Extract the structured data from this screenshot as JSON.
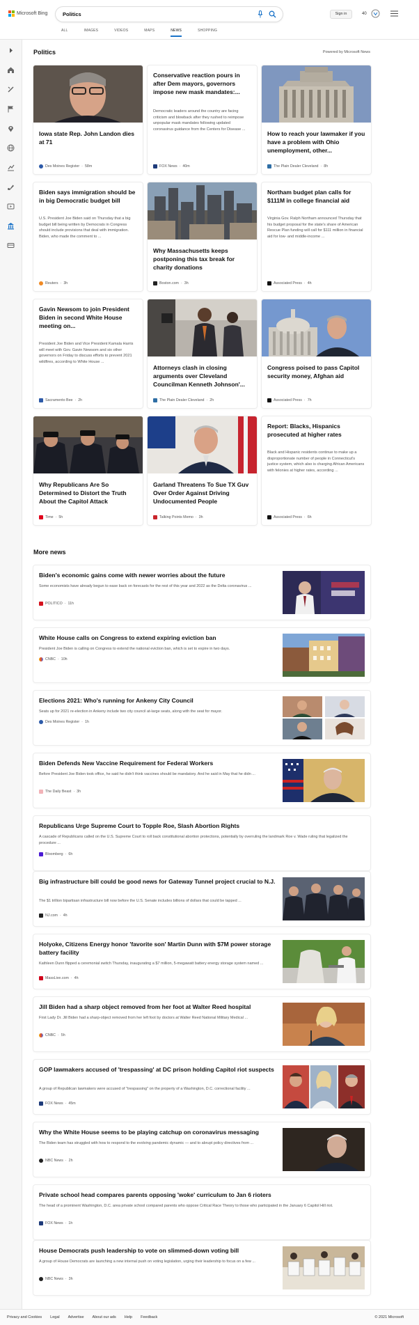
{
  "header": {
    "logo_text": "Microsoft Bing",
    "search_value": "Politics",
    "signin_label": "Sign in",
    "rewards_count": "40",
    "tabs": [
      "ALL",
      "IMAGES",
      "VIDEOS",
      "MAPS",
      "NEWS",
      "SHOPPING"
    ],
    "active_tab": "NEWS"
  },
  "colors": {
    "accent": "#1a73c8",
    "logo": [
      "#f25022",
      "#7fba00",
      "#00a4ef",
      "#ffb900"
    ]
  },
  "sidebar_icons": [
    "expand-icon",
    "home-icon",
    "sports-icon",
    "flag-icon",
    "location-icon",
    "world-icon",
    "money-icon",
    "science-icon",
    "entertainment-icon",
    "politics-icon",
    "more-icon"
  ],
  "section": {
    "title": "Politics",
    "powered_by": "Powered by Microsoft News"
  },
  "cards": [
    {
      "title": "Iowa state Rep. John Landon dies at 71",
      "desc": "",
      "source": "Des Moines Register",
      "time": "58m"
    },
    {
      "title": "Conservative reaction pours in after Dem mayors, governors impose new mask mandates:...",
      "desc": "Democratic leaders around the country are facing criticism and blowback after they rushed to reimpose unpopular mask mandates following updated coronavirus guidance from the Centers for Disease ...",
      "source": "FOX News",
      "time": "40m"
    },
    {
      "title": "How to reach your lawmaker if you have a problem with Ohio unemployment, other...",
      "desc": "",
      "source": "The Plain Dealer Cleveland",
      "time": "8h"
    },
    {
      "title": "Biden says immigration should be in big Democratic budget bill",
      "desc": "U.S. President Joe Biden said on Thursday that a big budget bill being written by Democrats in Congress should include provisions that deal with immigration. Biden, who made the comment to ...",
      "source": "Reuters",
      "time": "3h"
    },
    {
      "title": "Why Massachusetts keeps postponing this tax break for charity donations",
      "desc": "",
      "source": "Boston.com",
      "time": "3h"
    },
    {
      "title": "Northam budget plan calls for $111M in college financial aid",
      "desc": "Virginia Gov. Ralph Northam announced Thursday that his budget proposal for the state's share of American Rescue Plan funding will call for $111 million in financial aid for low- and middle-income ...",
      "source": "Associated Press",
      "time": "4h"
    },
    {
      "title": "Gavin Newsom to join President Biden in second White House meeting on...",
      "desc": "President Joe Biden and Vice President Kamala Harris will meet with Gov. Gavin Newsom and six other governors on Friday to discuss efforts to prevent 2021 wildfires, according to White House ...",
      "source": "Sacramento Bee",
      "time": "2h"
    },
    {
      "title": "Attorneys clash in closing arguments over Cleveland Councilman Kenneth Johnson'...",
      "desc": "",
      "source": "The Plain Dealer Cleveland",
      "time": "2h"
    },
    {
      "title": "Congress poised to pass Capitol security money, Afghan aid",
      "desc": "",
      "source": "Associated Press",
      "time": "7h"
    },
    {
      "title": "Why Republicans Are So Determined to Distort the Truth About the Capitol Attack",
      "desc": "",
      "source": "Time",
      "time": "5h"
    },
    {
      "title": "Garland Threatens To Sue TX Guv Over Order Against Driving Undocumented People",
      "desc": "",
      "source": "Talking Points Memo",
      "time": "3h"
    },
    {
      "title": "Report: Blacks, Hispanics prosecuted at higher rates",
      "desc": "Black and Hispanic residents continue to make up a disproportionate number of people in Connecticut's justice system, which also is charging African Americans with felonies at higher rates, according ...",
      "source": "Associated Press",
      "time": "6h"
    }
  ],
  "more_news": {
    "title": "More news",
    "items": [
      {
        "title": "Biden's economic gains come with newer worries about the future",
        "desc": "Some economists have already begun to ease back on forecasts for the rest of this year and 2022 as the Delta coronavirus ...",
        "source": "POLITICO",
        "time": "11h"
      },
      {
        "title": "White House calls on Congress to extend expiring eviction ban",
        "desc": "President Joe Biden is calling on Congress to extend the national eviction ban, which is set to expire in two days.",
        "source": "CNBC",
        "time": "10h"
      },
      {
        "title": "Elections 2021: Who's running for Ankeny City Council",
        "desc": "Seats up for 2021 re-election in Ankeny include two city council at-large seats, along with the seat for mayor.",
        "source": "Des Moines Register",
        "time": "1h"
      },
      {
        "title": "Biden Defends New Vaccine Requirement for Federal Workers",
        "desc": "Before President Joe Biden took office, he said he didn't think vaccines should be mandatory. And he said in May that he didn ...",
        "source": "The Daily Beast",
        "time": "3h"
      },
      {
        "title": "Republicans Urge Supreme Court to Topple Roe, Slash Abortion Rights",
        "desc": "A cascade of Republicans called on the U.S. Supreme Court to roll back constitutional abortion protections, potentially by overruling the landmark Roe v. Wade ruling that legalized the procedure ...",
        "source": "Bloomberg",
        "time": "6h"
      },
      {
        "title": "Big infrastructure bill could be good news for Gateway Tunnel project crucial to N.J.",
        "desc": "The $1 trillion bipartisan infrastructure bill now before the U.S. Senate includes billions of dollars that could be tapped ...",
        "source": "NJ.com",
        "time": "4h"
      },
      {
        "title": "Holyoke, Citizens Energy honor 'favorite son' Martin Dunn with $7M power storage battery facility",
        "desc": "Kathleen Dunn flipped a ceremonial switch Thursday, inaugurating a $7 million, 5-megawatt battery energy storage system named ...",
        "source": "MassLive.com",
        "time": "4h"
      },
      {
        "title": "Jill Biden had a sharp object removed from her foot at Walter Reed hospital",
        "desc": "First Lady Dr. Jill Biden had a sharp-object removed from her left foot by doctors at Walter Reed National Military Medical ...",
        "source": "CNBC",
        "time": "5h"
      },
      {
        "title": "GOP lawmakers accused of 'trespassing' at DC prison holding Capitol riot suspects",
        "desc": "A group of Republican lawmakers were accused of \"trespassing\" on the property of a Washington, D.C. correctional facility ...",
        "source": "FOX News",
        "time": "45m"
      },
      {
        "title": "Why the White House seems to be playing catchup on coronavirus messaging",
        "desc": "The Biden team has struggled with how to respond to the evolving pandemic dynamic — and to abrupt policy directives from ...",
        "source": "NBC News",
        "time": "2h"
      },
      {
        "title": "Private school head compares parents opposing 'woke' curriculum to Jan 6 rioters",
        "desc": "The head of a prominent Washington, D.C. area private school compared parents who oppose Critical Race Theory to those who participated in the January 6 Capitol Hill riot.",
        "source": "FOX News",
        "time": "1h"
      },
      {
        "title": "House Democrats push leadership to vote on slimmed-down voting bill",
        "desc": "A group of House Democrats are launching a new internal push on voting legislation, urging their leadership to focus on a few ...",
        "source": "NBC News",
        "time": "3h"
      }
    ]
  },
  "footer": {
    "links": [
      "Privacy and Cookies",
      "Legal",
      "Advertise",
      "About our ads",
      "Help",
      "Feedback"
    ],
    "copyright": "© 2021 Microsoft"
  }
}
